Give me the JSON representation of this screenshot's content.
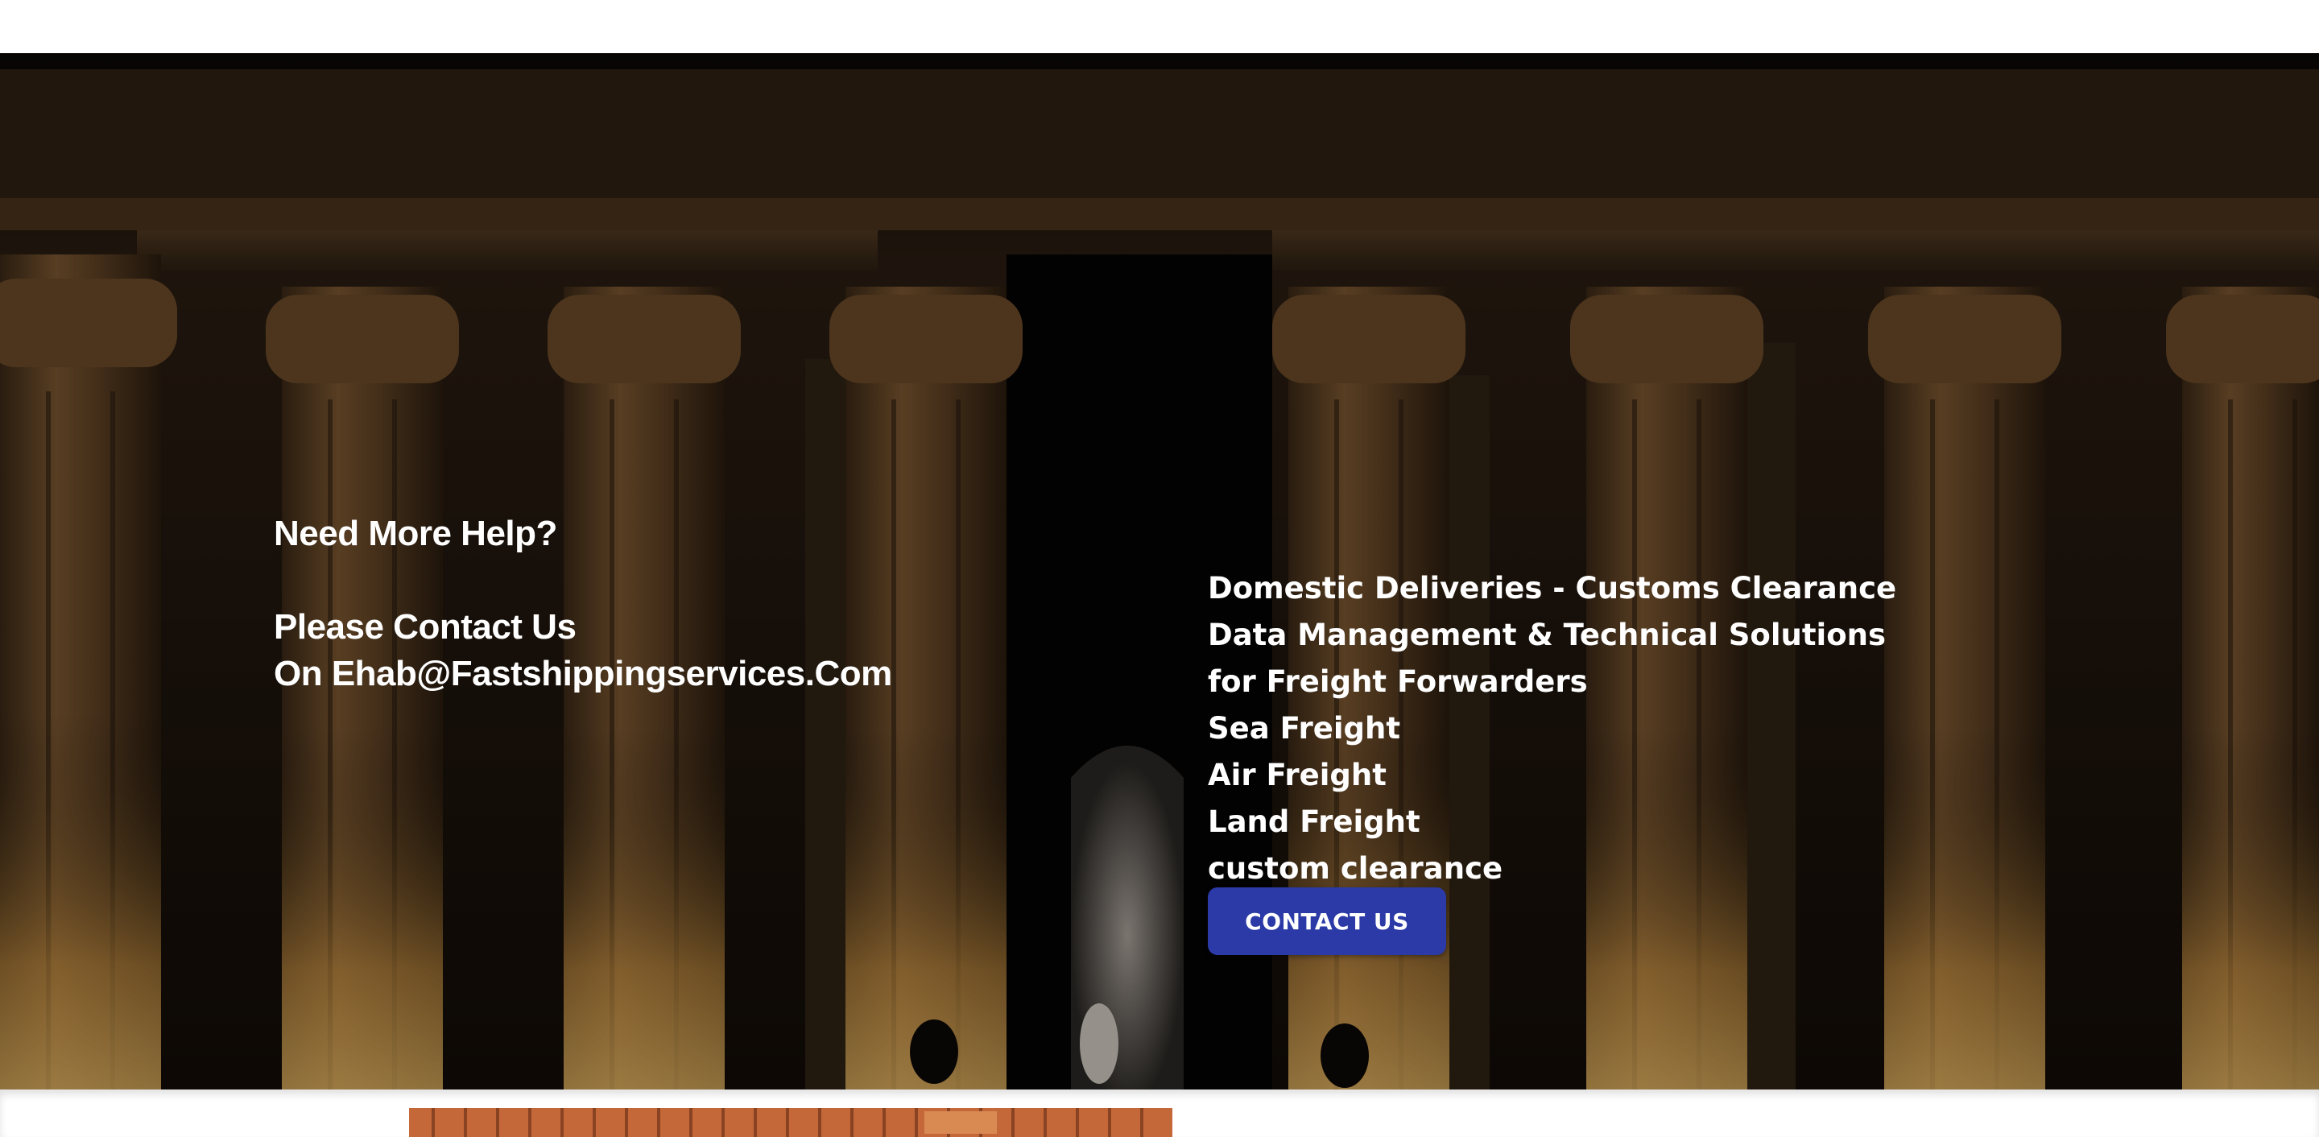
{
  "hero": {
    "background_image": "temple-columns-night-photo",
    "help": {
      "heading": "Need More Help?",
      "contact_line_1": "Please Contact Us",
      "contact_line_2": "On Ehab@Fastshippingservices.Com"
    },
    "services": {
      "intro": "Domestic Deliveries - Customs Clearance Data Management & Technical Solutions for Freight Forwarders",
      "items": [
        "Sea Freight",
        "Air Freight",
        "Land Freight",
        "custom clearance"
      ]
    },
    "contact_button_label": "CONTACT US"
  },
  "bottom": {
    "preview_image": "shipping-containers-photo"
  },
  "colors": {
    "button": "#2b3aa6",
    "text": "#ffffff",
    "page_background": "#ffffff"
  }
}
